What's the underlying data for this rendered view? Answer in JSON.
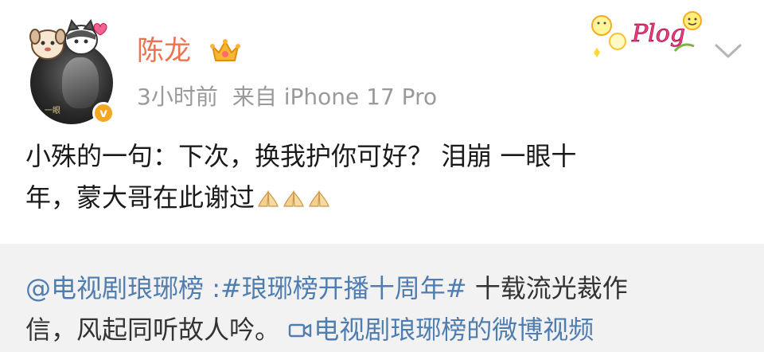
{
  "user": {
    "name": "陈龙",
    "avatar_caption": "一眼"
  },
  "meta": {
    "time": "3小时前",
    "source": "来自 iPhone 17 Pro"
  },
  "sticker": {
    "text": "Plog"
  },
  "post": {
    "line1": "小殊的一句：下次，换我护你可好？ 泪崩 一眼十",
    "line2": "年，蒙大哥在此谢过"
  },
  "repost": {
    "mention": "@电视剧琅琊榜",
    "separator": " :",
    "hashtag": "#琅琊榜开播十周年#",
    "body1": " 十载流光裁作",
    "body2": "信，风起同听故人吟。",
    "video_link": "电视剧琅琊榜的微博视频"
  },
  "colors": {
    "username": "#eb7350",
    "link": "#507daf",
    "verified": "#f5a623",
    "repost_bg": "#f2f2f2",
    "meta": "#9a9a9a"
  },
  "icons": [
    "cat-dog-pendant-icon",
    "verified-badge-icon",
    "crown-icon",
    "plog-sticker-icon",
    "chevron-down-icon",
    "praying-hands-icon",
    "video-camera-icon"
  ]
}
